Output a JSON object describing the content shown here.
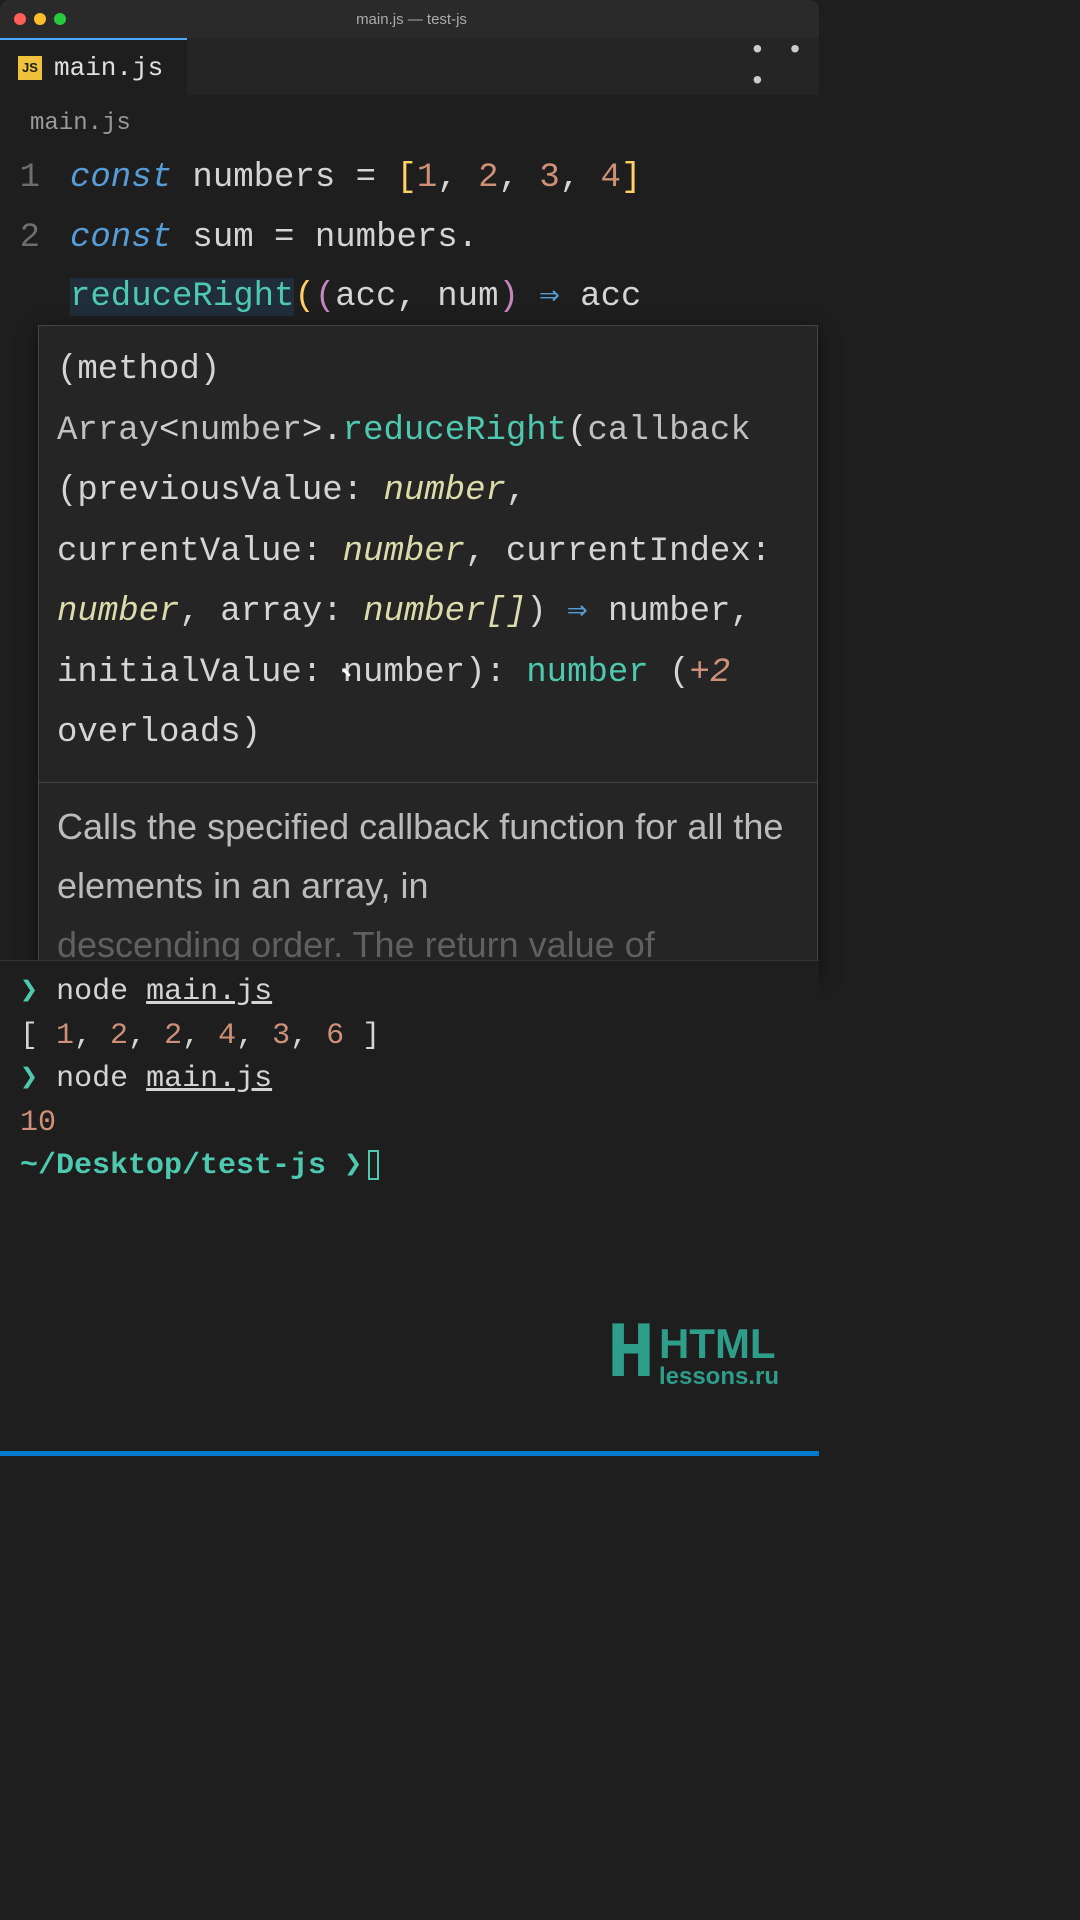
{
  "window": {
    "title": "main.js — test-js"
  },
  "tabbar": {
    "tabs": [
      {
        "icon": "JS",
        "label": "main.js"
      }
    ],
    "overflow": "• • •"
  },
  "breadcrumb": {
    "path": "main.js"
  },
  "editor": {
    "lines": [
      {
        "n": "1",
        "tokens": [
          {
            "cls": "tk-keyword",
            "t": "const "
          },
          {
            "cls": "tk-ident",
            "t": "numbers "
          },
          {
            "cls": "tk-op",
            "t": "= "
          },
          {
            "cls": "tk-punct",
            "t": "["
          },
          {
            "cls": "tk-num",
            "t": "1"
          },
          {
            "cls": "tk-op",
            "t": ", "
          },
          {
            "cls": "tk-num",
            "t": "2"
          },
          {
            "cls": "tk-op",
            "t": ", "
          },
          {
            "cls": "tk-num",
            "t": "3"
          },
          {
            "cls": "tk-op",
            "t": ", "
          },
          {
            "cls": "tk-num",
            "t": "4"
          },
          {
            "cls": "tk-punct",
            "t": "]"
          }
        ]
      },
      {
        "n": "2",
        "tokens": [
          {
            "cls": "tk-keyword",
            "t": "const "
          },
          {
            "cls": "tk-ident",
            "t": "sum "
          },
          {
            "cls": "tk-op",
            "t": "= numbers."
          }
        ]
      },
      {
        "n": " ",
        "tokens": [
          {
            "cls": "tk-method sel-highlight",
            "t": "reduceRight"
          },
          {
            "cls": "tk-punct",
            "t": "("
          },
          {
            "cls": "tk-punct2",
            "t": "("
          },
          {
            "cls": "tk-ident",
            "t": "acc, num"
          },
          {
            "cls": "tk-punct2",
            "t": ")"
          },
          {
            "cls": "tk-ident",
            "t": " "
          },
          {
            "cls": "tk-arrow",
            "t": "⇒"
          },
          {
            "cls": "tk-ident",
            "t": " acc "
          }
        ]
      }
    ]
  },
  "hover": {
    "sig_parts": [
      {
        "cls": "sig-punct",
        "t": "(method) "
      },
      {
        "cls": "sig-label",
        "t": "Array"
      },
      {
        "cls": "sig-punct",
        "t": "<"
      },
      {
        "cls": "sig-label",
        "t": "number"
      },
      {
        "cls": "sig-punct",
        "t": ">."
      },
      {
        "cls": "sig-type",
        "t": "reduceRight"
      },
      {
        "cls": "sig-punct",
        "t": "("
      },
      {
        "cls": "sig-label",
        "t": "callback "
      },
      {
        "cls": "sig-punct",
        "t": "(previousValue: "
      },
      {
        "cls": "sig-paramtype",
        "t": "number"
      },
      {
        "cls": "sig-punct",
        "t": ", currentValue: "
      },
      {
        "cls": "sig-paramtype",
        "t": "number"
      },
      {
        "cls": "sig-punct",
        "t": ", currentIndex: "
      },
      {
        "cls": "sig-paramtype",
        "t": "number"
      },
      {
        "cls": "sig-punct",
        "t": ", array: "
      },
      {
        "cls": "sig-paramtype",
        "t": "number[]"
      },
      {
        "cls": "sig-punct",
        "t": ") "
      },
      {
        "cls": "tk-arrow",
        "t": "⇒"
      },
      {
        "cls": "sig-punct",
        "t": " number, initialValue: number): "
      },
      {
        "cls": "sig-type",
        "t": "number"
      },
      {
        "cls": "sig-punct",
        "t": " ("
      },
      {
        "cls": "sig-overload",
        "t": "+2"
      },
      {
        "cls": "sig-punct",
        "t": " overloads)"
      }
    ],
    "description": "Calls the specified callback function for all the elements in an array, in",
    "description_fade": "descending order. The return value of"
  },
  "terminal": {
    "lines": [
      {
        "type": "cmd",
        "prompt": "❯",
        "cmd": "node ",
        "file": "main.js"
      },
      {
        "type": "out",
        "text": "[ 1, 2, 2, 4, 3, 6 ]"
      },
      {
        "type": "cmd",
        "prompt": "❯",
        "cmd": "node ",
        "file": "main.js"
      },
      {
        "type": "out-num",
        "text": "10"
      },
      {
        "type": "cwd",
        "cwd": "~/Desktop/test-js ",
        "prompt": "❯"
      }
    ]
  },
  "watermark": {
    "logo": "H",
    "big": "HTML",
    "small": "lessons.ru"
  }
}
